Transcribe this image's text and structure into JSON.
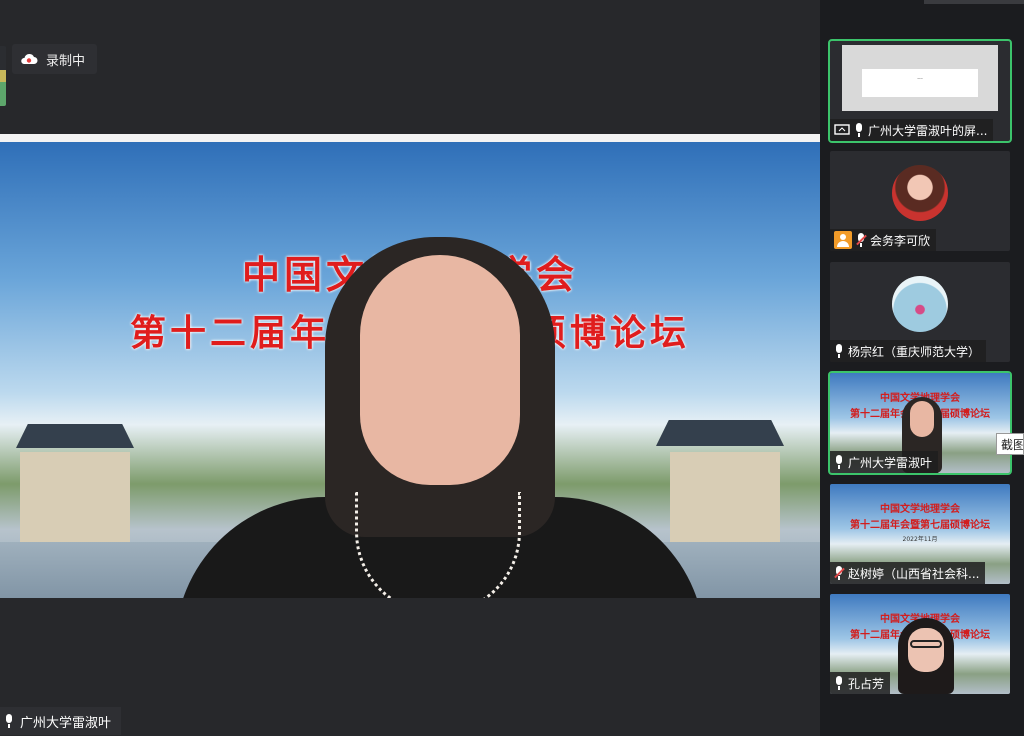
{
  "recording": {
    "label": "录制中",
    "icon": "cloud-record-icon"
  },
  "main_video": {
    "banner_line1": "中国文学地理学会",
    "banner_line2": "第十二届年会暨第七届硕博论坛",
    "speaker_name": "广州大学雷淑叶"
  },
  "sidebar": {
    "tiles": [
      {
        "name": "广州大学雷淑叶的屏...",
        "type": "screen-share",
        "slide_text": "...",
        "active": true
      },
      {
        "name": "会务李可欣",
        "type": "avatar",
        "muted": true
      },
      {
        "name": "杨宗红（重庆师范大学）",
        "type": "avatar",
        "muted": false
      },
      {
        "name": "广州大学雷淑叶",
        "type": "video",
        "active": true,
        "mini_line1": "中国文学地理学会",
        "mini_line2": "第十二届年会暨第七届硕博论坛"
      },
      {
        "name": "赵树婷（山西省社会科...",
        "type": "video",
        "muted": true,
        "mini_line1": "中国文学地理学会",
        "mini_line2": "第十二届年会暨第七届硕博论坛",
        "mini_line3": "2022年11月"
      },
      {
        "name": "孔占芳",
        "type": "video",
        "mini_line1": "中国文学地理学会",
        "mini_line2": "第十二届年会暨第七届硕博论坛"
      }
    ]
  },
  "screenshot_tooltip": "截图",
  "colors": {
    "accent_active": "#3cc46b",
    "banner_red": "#e01d1d"
  }
}
